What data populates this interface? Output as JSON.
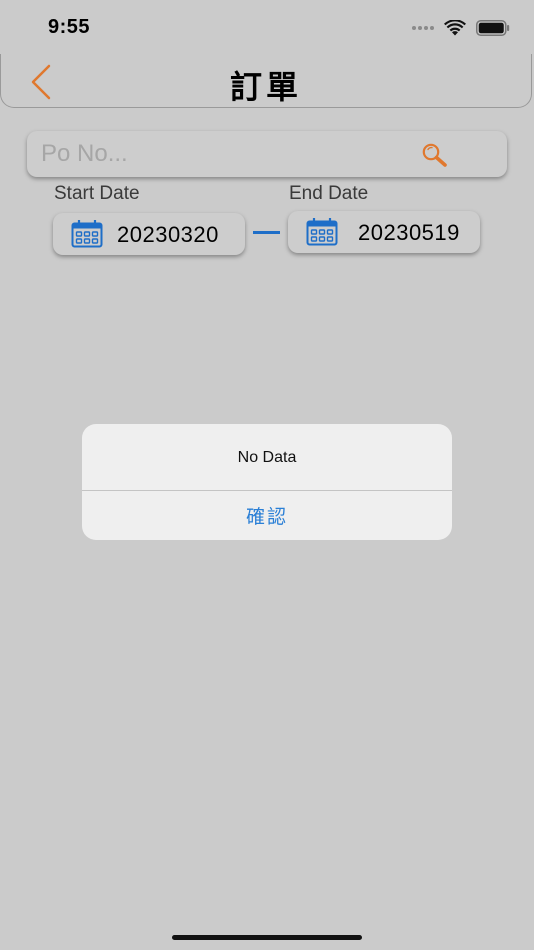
{
  "status_bar": {
    "time": "9:55"
  },
  "nav": {
    "title": "訂單",
    "back_icon": "chevron-left-icon",
    "accent_color": "#e0782e"
  },
  "search": {
    "placeholder": "Po No...",
    "value": "",
    "icon": "search-icon"
  },
  "dates": {
    "start_label": "Start Date",
    "start_value": "20230320",
    "end_label": "End Date",
    "end_value": "20230519",
    "icon": "calendar-icon",
    "icon_color": "#1e6ec8"
  },
  "alert": {
    "message": "No Data",
    "confirm_label": "確認",
    "confirm_color": "#2a7fd6"
  }
}
